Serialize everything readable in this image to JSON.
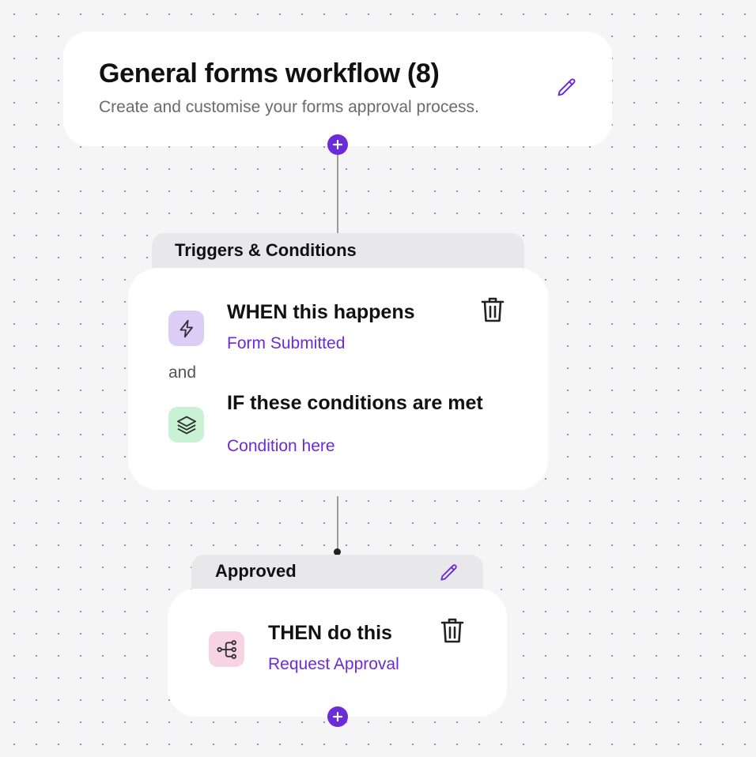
{
  "workflow": {
    "title": "General forms workflow (8)",
    "description": "Create and customise your forms approval process."
  },
  "triggers_group": {
    "label": "Triggers & Conditions",
    "when": {
      "title": "WHEN this happens",
      "link": "Form Submitted",
      "icon": "lightning-icon"
    },
    "connector_text": "and",
    "if": {
      "title": "IF these conditions are met",
      "link": "Condition here",
      "icon": "layers-icon"
    }
  },
  "approved_group": {
    "label": "Approved",
    "then": {
      "title": "THEN do this",
      "link": "Request Approval",
      "icon": "flow-branch-icon"
    }
  },
  "colors": {
    "accent": "#6c2bd9",
    "canvas": "#f5f5f6",
    "dot_grid": "#8d86e6",
    "when_tile": "#dccdf7",
    "if_tile": "#c9f2d4",
    "then_tile": "#f7d3e4"
  }
}
